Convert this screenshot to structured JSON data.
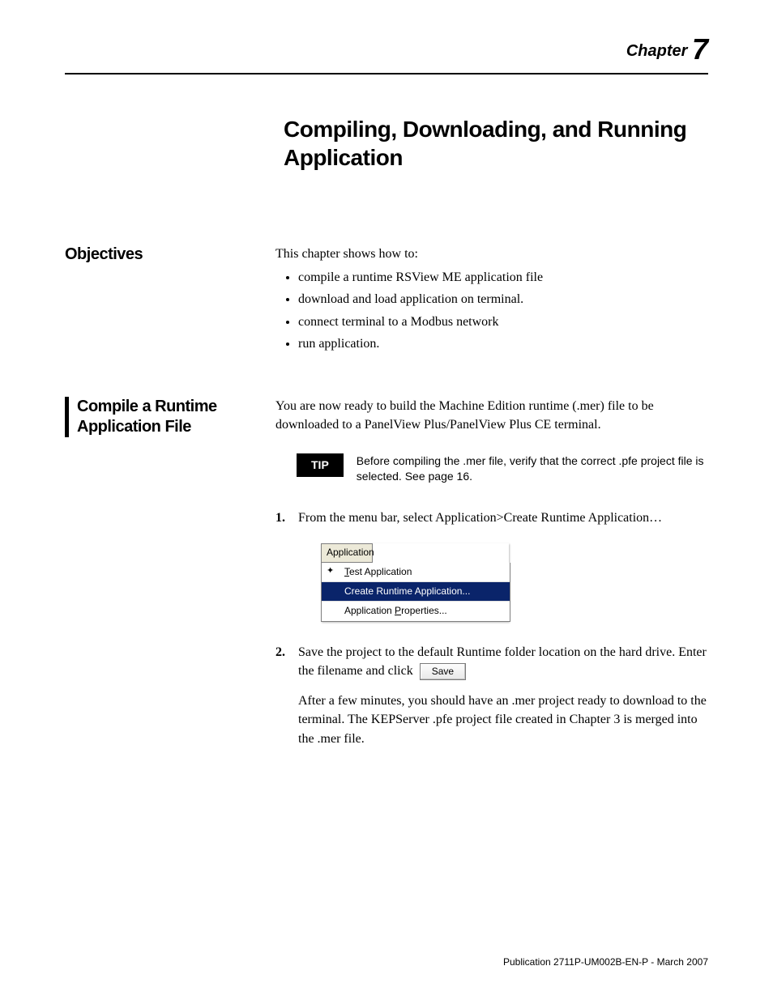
{
  "chapter": {
    "label": "Chapter",
    "number": "7"
  },
  "title": "Compiling, Downloading, and Running Application",
  "objectives": {
    "heading": "Objectives",
    "intro": "This chapter shows how to:",
    "items": [
      "compile a runtime RSView ME application file",
      "download and load application on terminal.",
      "connect terminal to a Modbus network",
      "run application."
    ]
  },
  "compile": {
    "heading": "Compile a Runtime Application File",
    "intro": "You are now ready to build the Machine Edition runtime (.mer) file to be downloaded to a PanelView Plus/PanelView Plus CE terminal.",
    "tip_label": "TIP",
    "tip_text": "Before compiling the .mer file, verify that the correct .pfe project file is selected. See page 16.",
    "step1": "From the menu bar, select Application>Create Runtime Application…",
    "menu": {
      "header": "Application",
      "item1_pre": "T",
      "item1_rest": "est Application",
      "item2": "Create Runtime Application...",
      "item3_pre": "Application ",
      "item3_underlined": "P",
      "item3_rest": "roperties..."
    },
    "step2a": "Save the project to the default Runtime folder location on the hard drive. Enter the filename and click",
    "save_label": "Save",
    "step2b": "After a few minutes, you should have an .mer project ready to download to the terminal. The KEPServer .pfe project file created in Chapter 3 is merged into the .mer file."
  },
  "footer": "Publication 2711P-UM002B-EN-P - March 2007"
}
